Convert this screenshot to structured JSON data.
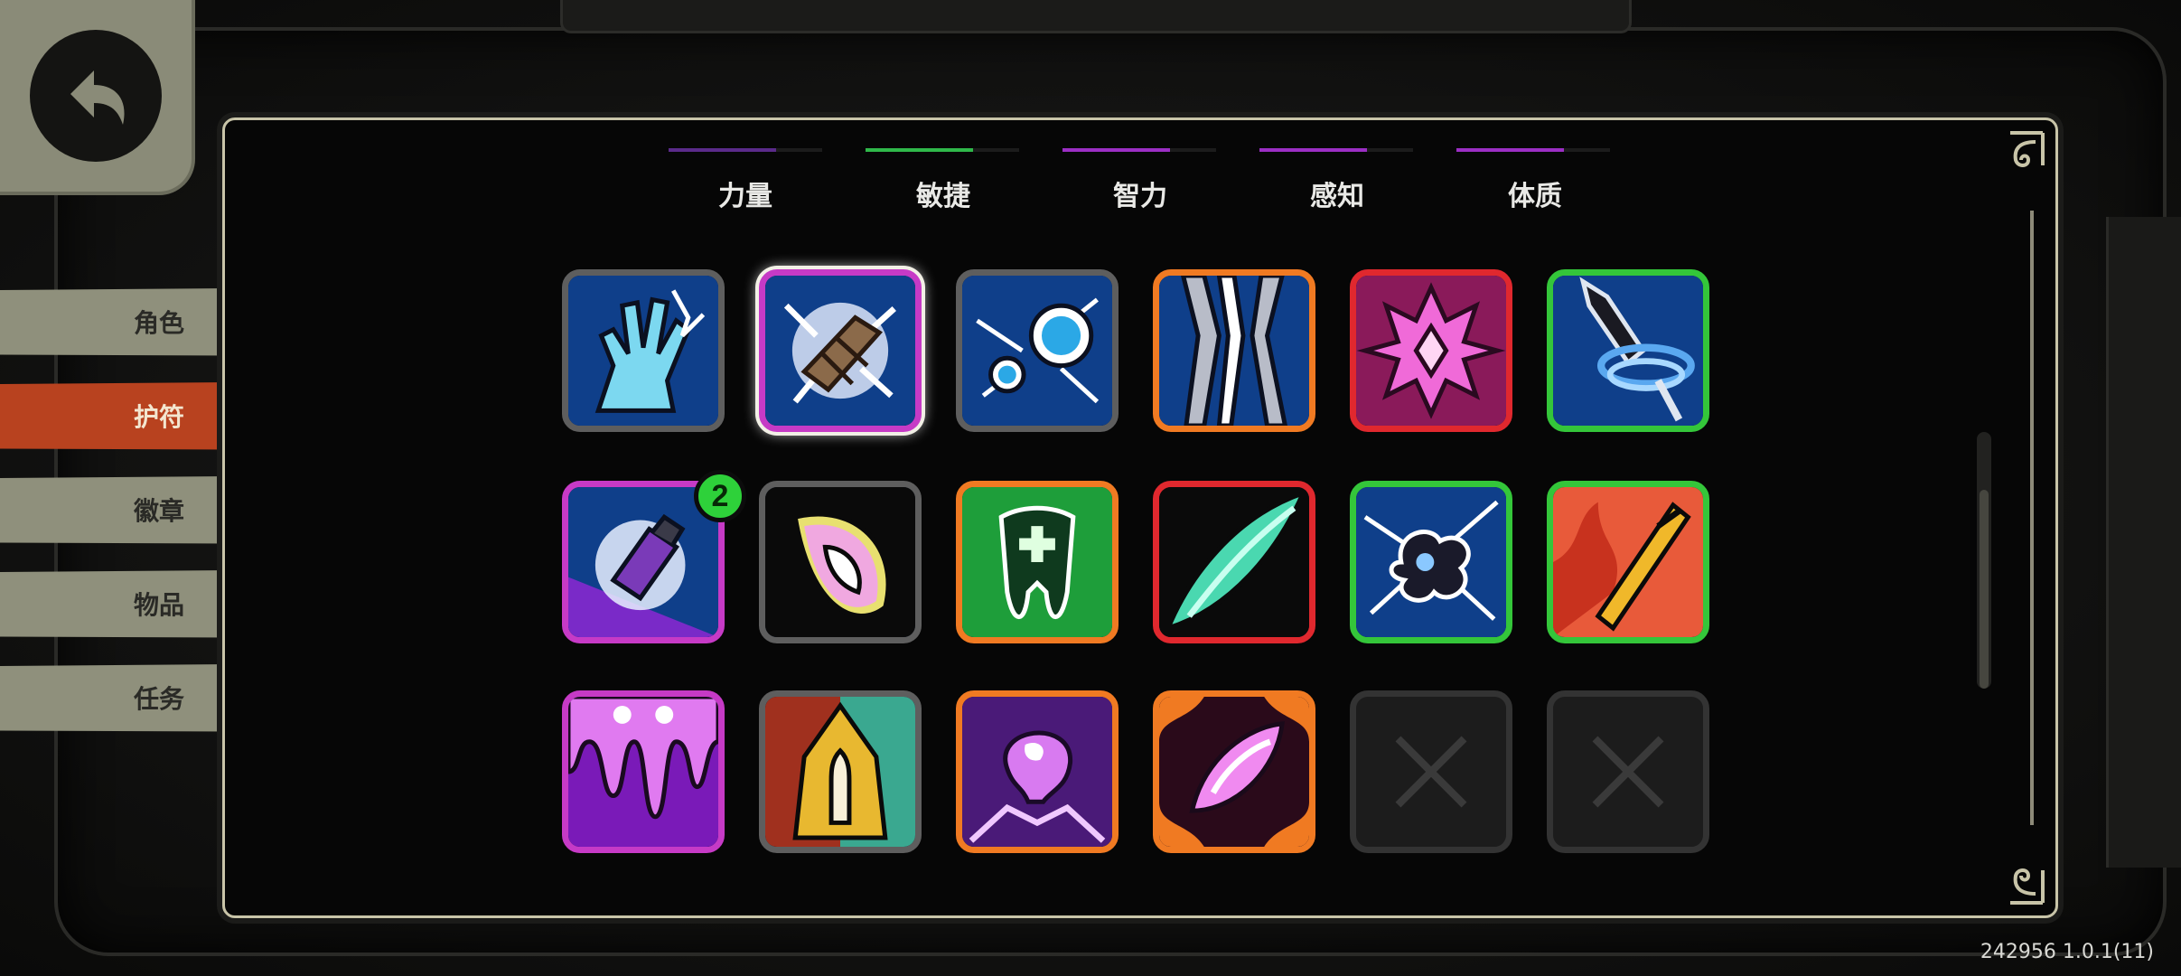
{
  "nav": {
    "items": [
      {
        "label": "角色",
        "active": false
      },
      {
        "label": "护符",
        "active": true
      },
      {
        "label": "徽章",
        "active": false
      },
      {
        "label": "物品",
        "active": false
      },
      {
        "label": "任务",
        "active": false
      }
    ]
  },
  "stats": [
    "力量",
    "敏捷",
    "智力",
    "感知",
    "体质"
  ],
  "stat_colors": [
    "#5a2a8a",
    "#2fb84a",
    "#9b2ec4",
    "#9b2ec4",
    "#9b2ec4"
  ],
  "tiles": [
    {
      "icon": "blue-hand-icon",
      "border": "#5e5e5e"
    },
    {
      "icon": "crystal-rock-icon",
      "border": "#c63ac6",
      "selected": true
    },
    {
      "icon": "orb-bubbles-icon",
      "border": "#5e5e5e"
    },
    {
      "icon": "lightning-claws-icon",
      "border": "#f07a22"
    },
    {
      "icon": "pink-sigil-icon",
      "border": "#e0282e"
    },
    {
      "icon": "spinning-blade-icon",
      "border": "#34c63a"
    },
    {
      "icon": "potion-vial-icon",
      "border": "#c63ac6",
      "badge": "2"
    },
    {
      "icon": "pink-flame-icon",
      "border": "#5e5e5e"
    },
    {
      "icon": "green-tooth-cross-icon",
      "border": "#f07a22"
    },
    {
      "icon": "teal-leaf-slash-icon",
      "border": "#e0282e"
    },
    {
      "icon": "smoke-burst-icon",
      "border": "#34c63a"
    },
    {
      "icon": "fire-sword-icon",
      "border": "#34c63a"
    },
    {
      "icon": "purple-drip-icon",
      "border": "#c63ac6"
    },
    {
      "icon": "gold-bullet-icon",
      "border": "#5e5e5e"
    },
    {
      "icon": "purple-skull-splash-icon",
      "border": "#f07a22"
    },
    {
      "icon": "pink-crystal-ornament-icon",
      "border": "#f07a22"
    },
    {
      "icon": "empty-slot-x-icon",
      "border": "#333333",
      "empty": true
    },
    {
      "icon": "empty-slot-x-icon",
      "border": "#333333",
      "empty": true
    }
  ],
  "version": "242956 1.0.1(11)"
}
